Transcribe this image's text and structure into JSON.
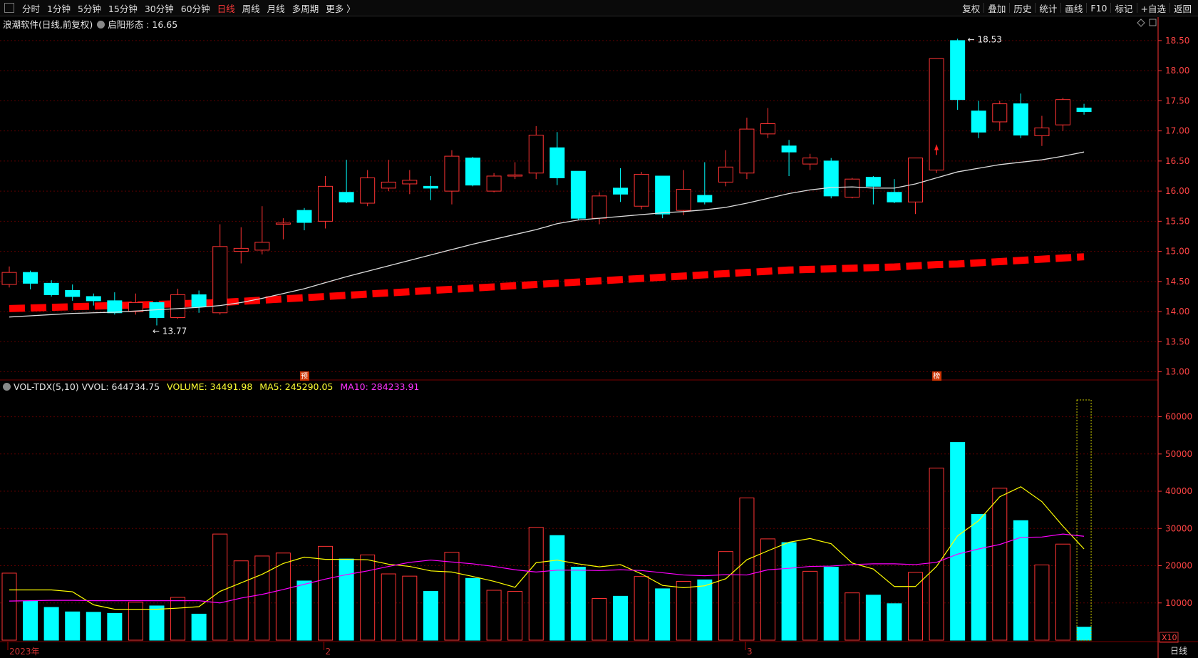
{
  "toolbar": {
    "periods": [
      "分时",
      "1分钟",
      "5分钟",
      "15分钟",
      "30分钟",
      "60分钟",
      "日线",
      "周线",
      "月线",
      "多周期",
      "更多 〉"
    ],
    "active_index": 6,
    "right_items": [
      "复权",
      "叠加",
      "历史",
      "统计",
      "画线",
      "F10",
      "标记",
      "+自选",
      "返回"
    ]
  },
  "header": {
    "stock": "浪潮软件(日线,前复权)",
    "indicator_label": "启阳形态 : 16.65"
  },
  "volume_header": {
    "name": "VOL-TDX(5,10)",
    "vvol_label": "VVOL: 644734.75",
    "volume_label": "VOLUME: 34491.98",
    "ma5_label": "MA5: 245290.05",
    "ma10_label": "MA10: 284233.91"
  },
  "colors": {
    "up": "#ff3333",
    "down": "#00ffff",
    "ma_line": "#dddddd",
    "ma5": "#ffff00",
    "ma10": "#ff00ff",
    "grid": "#5a0000",
    "axis": "#ff3333"
  },
  "chart_data": [
    {
      "type": "candlestick",
      "title": "浪潮软件(日线,前复权)",
      "ylim": [
        12.9,
        18.7
      ],
      "y_ticks": [
        13.0,
        13.5,
        14.0,
        14.5,
        15.0,
        15.5,
        16.0,
        16.5,
        17.0,
        17.5,
        18.0,
        18.5
      ],
      "x_labels": [
        {
          "index": 0,
          "label": "2023年"
        },
        {
          "index": 15,
          "label": "2"
        },
        {
          "index": 35,
          "label": "3"
        }
      ],
      "annotations": [
        {
          "index": 7,
          "value": 13.77,
          "label": "13.77"
        },
        {
          "index": 45,
          "value": 18.53,
          "label": "18.53"
        },
        {
          "index": 14,
          "label": "预"
        },
        {
          "index": 44,
          "label": "榜"
        }
      ],
      "candles": [
        {
          "o": 14.45,
          "h": 14.75,
          "l": 14.4,
          "c": 14.65
        },
        {
          "o": 14.65,
          "h": 14.68,
          "l": 14.37,
          "c": 14.47
        },
        {
          "o": 14.47,
          "h": 14.52,
          "l": 14.25,
          "c": 14.28
        },
        {
          "o": 14.35,
          "h": 14.45,
          "l": 14.18,
          "c": 14.25
        },
        {
          "o": 14.25,
          "h": 14.3,
          "l": 14.1,
          "c": 14.18
        },
        {
          "o": 14.18,
          "h": 14.32,
          "l": 13.95,
          "c": 13.98
        },
        {
          "o": 14.0,
          "h": 14.3,
          "l": 13.95,
          "c": 14.15
        },
        {
          "o": 14.15,
          "h": 14.16,
          "l": 13.77,
          "c": 13.9
        },
        {
          "o": 13.9,
          "h": 14.38,
          "l": 13.88,
          "c": 14.28
        },
        {
          "o": 14.28,
          "h": 14.35,
          "l": 13.98,
          "c": 14.08
        },
        {
          "o": 13.98,
          "h": 15.45,
          "l": 13.95,
          "c": 15.08
        },
        {
          "o": 15.0,
          "h": 15.4,
          "l": 14.8,
          "c": 15.05
        },
        {
          "o": 15.02,
          "h": 15.75,
          "l": 14.95,
          "c": 15.15
        },
        {
          "o": 15.45,
          "h": 15.55,
          "l": 15.2,
          "c": 15.47
        },
        {
          "o": 15.68,
          "h": 15.72,
          "l": 15.35,
          "c": 15.48
        },
        {
          "o": 15.5,
          "h": 16.25,
          "l": 15.38,
          "c": 16.08
        },
        {
          "o": 15.98,
          "h": 16.52,
          "l": 15.8,
          "c": 15.82
        },
        {
          "o": 15.8,
          "h": 16.35,
          "l": 15.75,
          "c": 16.22
        },
        {
          "o": 16.05,
          "h": 16.52,
          "l": 16.0,
          "c": 16.15
        },
        {
          "o": 16.12,
          "h": 16.35,
          "l": 15.95,
          "c": 16.18
        },
        {
          "o": 16.08,
          "h": 16.25,
          "l": 15.85,
          "c": 16.05
        },
        {
          "o": 16.0,
          "h": 16.68,
          "l": 15.78,
          "c": 16.58
        },
        {
          "o": 16.55,
          "h": 16.57,
          "l": 16.08,
          "c": 16.1
        },
        {
          "o": 16.0,
          "h": 16.3,
          "l": 15.98,
          "c": 16.25
        },
        {
          "o": 16.25,
          "h": 16.48,
          "l": 16.2,
          "c": 16.27
        },
        {
          "o": 16.3,
          "h": 17.08,
          "l": 16.2,
          "c": 16.93
        },
        {
          "o": 16.72,
          "h": 16.98,
          "l": 16.1,
          "c": 16.22
        },
        {
          "o": 16.33,
          "h": 16.33,
          "l": 15.52,
          "c": 15.55
        },
        {
          "o": 15.55,
          "h": 15.98,
          "l": 15.45,
          "c": 15.92
        },
        {
          "o": 16.05,
          "h": 16.38,
          "l": 15.82,
          "c": 15.95
        },
        {
          "o": 15.75,
          "h": 16.32,
          "l": 15.7,
          "c": 16.28
        },
        {
          "o": 16.25,
          "h": 16.25,
          "l": 15.55,
          "c": 15.62
        },
        {
          "o": 15.68,
          "h": 16.35,
          "l": 15.6,
          "c": 16.03
        },
        {
          "o": 15.93,
          "h": 16.48,
          "l": 15.78,
          "c": 15.82
        },
        {
          "o": 16.15,
          "h": 16.68,
          "l": 16.08,
          "c": 16.4
        },
        {
          "o": 16.3,
          "h": 17.22,
          "l": 16.2,
          "c": 17.03
        },
        {
          "o": 16.95,
          "h": 17.38,
          "l": 16.88,
          "c": 17.12
        },
        {
          "o": 16.75,
          "h": 16.85,
          "l": 16.25,
          "c": 16.65
        },
        {
          "o": 16.45,
          "h": 16.62,
          "l": 16.35,
          "c": 16.55
        },
        {
          "o": 16.5,
          "h": 16.55,
          "l": 15.88,
          "c": 15.92
        },
        {
          "o": 15.9,
          "h": 16.22,
          "l": 15.88,
          "c": 16.2
        },
        {
          "o": 16.23,
          "h": 16.25,
          "l": 15.78,
          "c": 16.08
        },
        {
          "o": 15.98,
          "h": 16.2,
          "l": 15.8,
          "c": 15.82
        },
        {
          "o": 15.82,
          "h": 16.55,
          "l": 15.62,
          "c": 16.55
        },
        {
          "o": 16.35,
          "h": 18.2,
          "l": 16.3,
          "c": 18.2
        },
        {
          "o": 18.5,
          "h": 18.53,
          "l": 17.35,
          "c": 17.52
        },
        {
          "o": 17.33,
          "h": 17.5,
          "l": 16.88,
          "c": 16.98
        },
        {
          "o": 17.15,
          "h": 17.5,
          "l": 17.0,
          "c": 17.45
        },
        {
          "o": 17.45,
          "h": 17.62,
          "l": 16.88,
          "c": 16.93
        },
        {
          "o": 16.92,
          "h": 17.25,
          "l": 16.75,
          "c": 17.05
        },
        {
          "o": 17.1,
          "h": 17.55,
          "l": 17.0,
          "c": 17.52
        },
        {
          "o": 17.38,
          "h": 17.45,
          "l": 17.27,
          "c": 17.32
        }
      ],
      "ma_line": [
        13.91,
        13.93,
        13.95,
        13.97,
        13.98,
        13.99,
        14.01,
        14.03,
        14.05,
        14.07,
        14.1,
        14.15,
        14.22,
        14.3,
        14.38,
        14.48,
        14.58,
        14.67,
        14.76,
        14.85,
        14.94,
        15.03,
        15.12,
        15.2,
        15.28,
        15.36,
        15.46,
        15.52,
        15.55,
        15.58,
        15.61,
        15.64,
        15.66,
        15.69,
        15.73,
        15.8,
        15.88,
        15.96,
        16.02,
        16.06,
        16.07,
        16.05,
        16.05,
        16.12,
        16.22,
        16.32,
        16.38,
        16.44,
        16.48,
        16.52,
        16.58,
        16.65
      ],
      "long_ma": [
        14.05,
        14.06,
        14.07,
        14.08,
        14.09,
        14.1,
        14.11,
        14.12,
        14.13,
        14.14,
        14.15,
        14.17,
        14.19,
        14.21,
        14.23,
        14.25,
        14.27,
        14.29,
        14.31,
        14.33,
        14.35,
        14.37,
        14.39,
        14.41,
        14.43,
        14.45,
        14.47,
        14.49,
        14.51,
        14.53,
        14.55,
        14.57,
        14.59,
        14.61,
        14.63,
        14.65,
        14.67,
        14.69,
        14.7,
        14.71,
        14.72,
        14.73,
        14.74,
        14.76,
        14.78,
        14.79,
        14.81,
        14.83,
        14.85,
        14.87,
        14.89,
        14.91
      ]
    },
    {
      "type": "bar",
      "title": "VOL-TDX(5,10)",
      "ylim": [
        0,
        67000
      ],
      "y_ticks": [
        10000,
        20000,
        30000,
        40000,
        50000,
        60000
      ],
      "unit_label": "X10",
      "values": [
        18000,
        10500,
        8800,
        7600,
        7500,
        7200,
        10200,
        9200,
        11500,
        7000,
        28500,
        21300,
        22600,
        23400,
        15900,
        25200,
        21800,
        22900,
        17800,
        17200,
        13100,
        23600,
        16600,
        13400,
        13100,
        30300,
        28100,
        19600,
        11200,
        11800,
        17100,
        13800,
        15800,
        16200,
        23800,
        38200,
        27200,
        26200,
        18500,
        19600,
        12700,
        12100,
        9800,
        18200,
        46200,
        53100,
        33800,
        40800,
        32100,
        20200,
        25800,
        3500
      ],
      "ma5": [
        13500,
        13500,
        13500,
        13000,
        9500,
        8300,
        8300,
        8300,
        8600,
        9000,
        13100,
        15400,
        17700,
        20600,
        22300,
        21700,
        21700,
        21600,
        20400,
        19800,
        18600,
        18300,
        17100,
        15800,
        14200,
        20800,
        21500,
        20500,
        19700,
        20300,
        17800,
        14700,
        14100,
        14600,
        16500,
        21600,
        24000,
        26300,
        27300,
        25900,
        20700,
        19100,
        14400,
        14400,
        19800,
        28000,
        32100,
        38500,
        41200,
        37200,
        30600,
        24500
      ],
      "ma10": [
        10500,
        10600,
        10700,
        10700,
        10600,
        10600,
        10600,
        10600,
        10600,
        10600,
        10000,
        11300,
        12300,
        13600,
        15000,
        16400,
        17600,
        18600,
        19800,
        20900,
        21500,
        21000,
        20500,
        19800,
        18900,
        18300,
        18800,
        18800,
        18700,
        18900,
        18700,
        18100,
        17500,
        17300,
        17600,
        17500,
        18900,
        19300,
        19800,
        19900,
        20300,
        20500,
        20500,
        20300,
        20900,
        23100,
        24500,
        25700,
        27600,
        27700,
        28500,
        27900
      ]
    }
  ]
}
